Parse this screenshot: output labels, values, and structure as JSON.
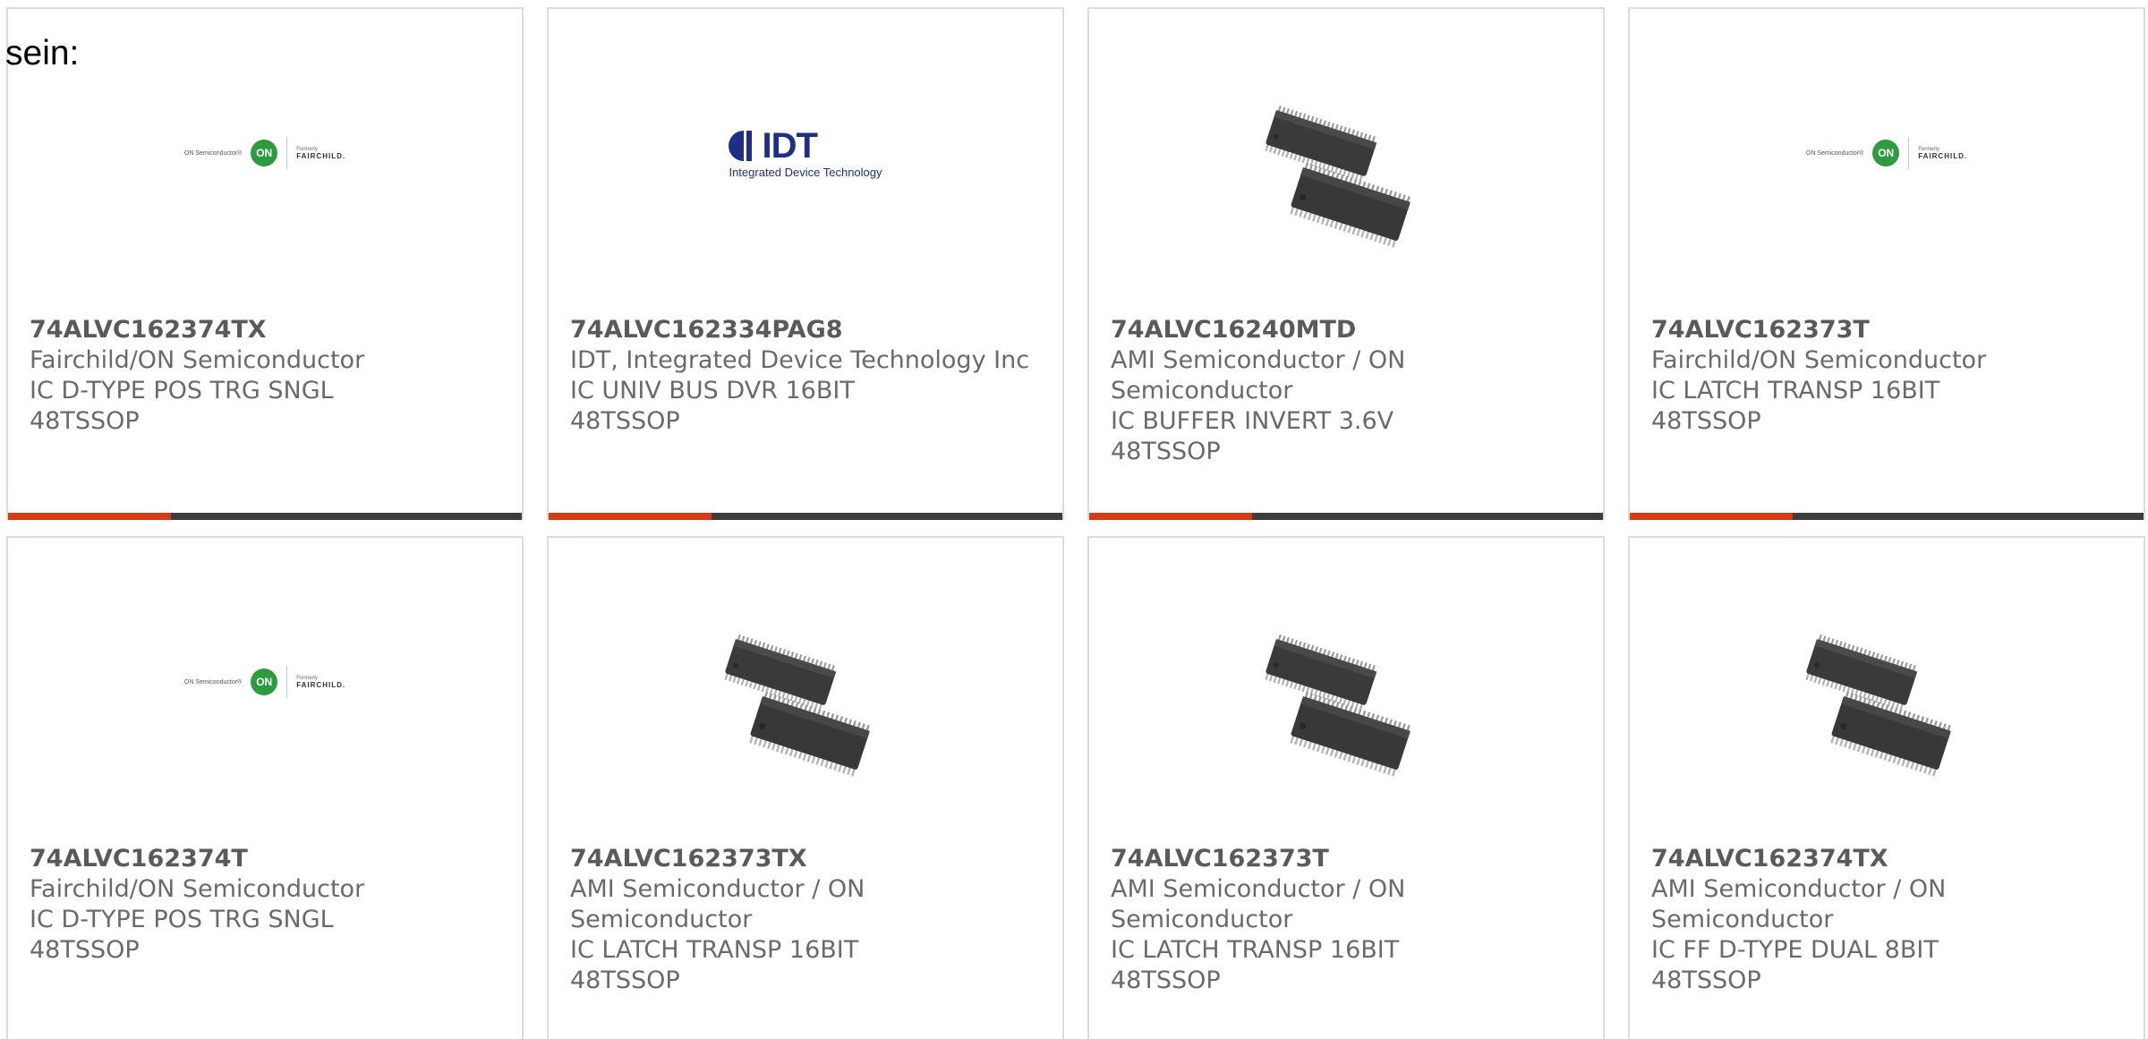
{
  "intro_text": "sein:",
  "accent_color": "#d83a14",
  "bar_color": "#3d3d3d",
  "cards": [
    {
      "part": "74ALVC162374TX",
      "manufacturer": "Fairchild/ON Semiconductor",
      "description": "IC D-TYPE POS TRG SNGL",
      "package": "48TSSOP",
      "image": "onsemi-fairchild-logo",
      "logo": {
        "on_text": "ON Semiconductor®",
        "on_badge": "ON",
        "formerly": "Formerly",
        "fairchild": "FAIRCHILD."
      }
    },
    {
      "part": "74ALVC162334PAG8",
      "manufacturer": "IDT, Integrated Device Technology Inc",
      "description": "IC UNIV BUS DVR 16BIT",
      "package": "48TSSOP",
      "image": "idt-logo",
      "logo": {
        "idt_word": "IDT",
        "idt_sub": "Integrated Device Technology"
      }
    },
    {
      "part": "74ALVC16240MTD",
      "manufacturer": "AMI Semiconductor / ON Semiconductor",
      "description": "IC BUFFER INVERT 3.6V",
      "package": "48TSSOP",
      "image": "tssop-chip-photo"
    },
    {
      "part": "74ALVC162373T",
      "manufacturer": "Fairchild/ON Semiconductor",
      "description": "IC LATCH TRANSP 16BIT",
      "package": "48TSSOP",
      "image": "onsemi-fairchild-logo",
      "logo": {
        "on_text": "ON Semiconductor®",
        "on_badge": "ON",
        "formerly": "Formerly",
        "fairchild": "FAIRCHILD."
      }
    },
    {
      "part": "74ALVC162374T",
      "manufacturer": "Fairchild/ON Semiconductor",
      "description": "IC D-TYPE POS TRG SNGL",
      "package": "48TSSOP",
      "image": "onsemi-fairchild-logo",
      "logo": {
        "on_text": "ON Semiconductor®",
        "on_badge": "ON",
        "formerly": "Formerly",
        "fairchild": "FAIRCHILD."
      }
    },
    {
      "part": "74ALVC162373TX",
      "manufacturer": "AMI Semiconductor / ON Semiconductor",
      "description": "IC LATCH TRANSP 16BIT",
      "package": "48TSSOP",
      "image": "tssop-chip-photo"
    },
    {
      "part": "74ALVC162373T",
      "manufacturer": "AMI Semiconductor / ON Semiconductor",
      "description": "IC LATCH TRANSP 16BIT",
      "package": "48TSSOP",
      "image": "tssop-chip-photo"
    },
    {
      "part": "74ALVC162374TX",
      "manufacturer": "AMI Semiconductor / ON Semiconductor",
      "description": "IC FF D-TYPE DUAL 8BIT",
      "package": "48TSSOP",
      "image": "tssop-chip-photo"
    }
  ]
}
